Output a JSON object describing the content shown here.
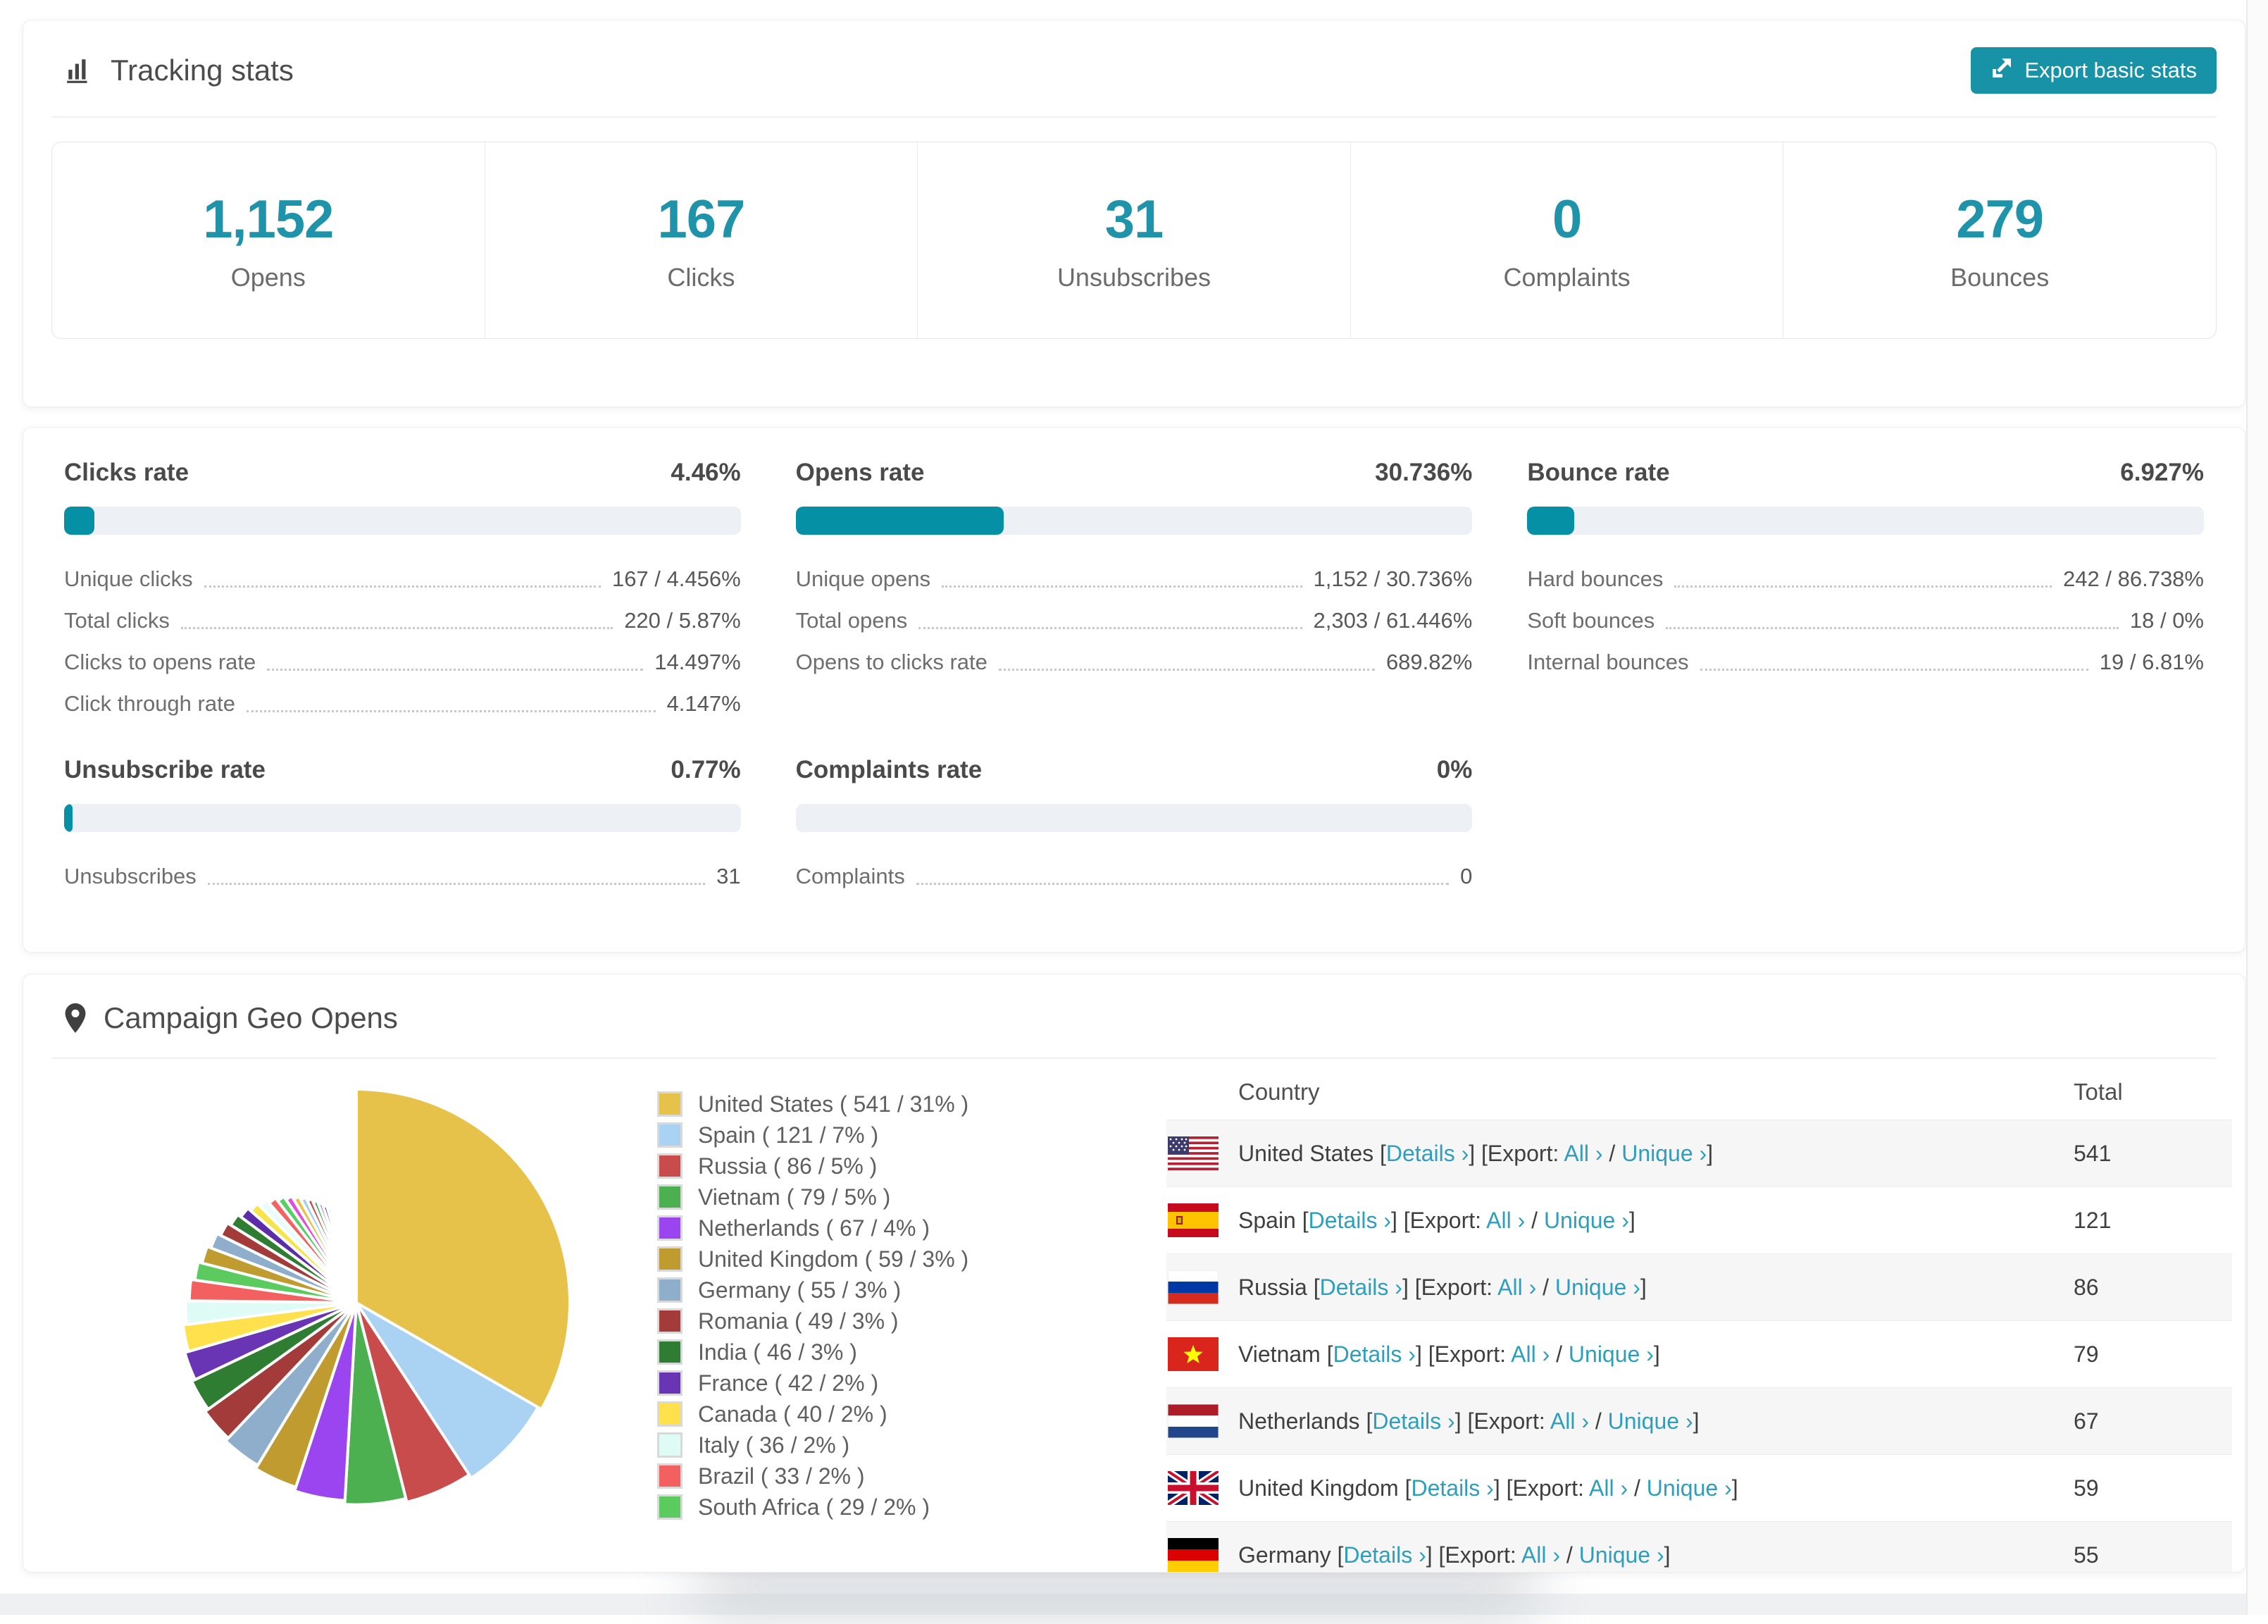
{
  "tracking": {
    "title": "Tracking stats",
    "export_label": "Export basic stats",
    "stats": [
      {
        "value": "1,152",
        "label": "Opens"
      },
      {
        "value": "167",
        "label": "Clicks"
      },
      {
        "value": "31",
        "label": "Unsubscribes"
      },
      {
        "value": "0",
        "label": "Complaints"
      },
      {
        "value": "279",
        "label": "Bounces"
      }
    ]
  },
  "rates": {
    "accent_color": "#0690A5",
    "blocks": [
      {
        "title": "Clicks rate",
        "value": "4.46%",
        "pct": 4.46,
        "rows": [
          [
            "Unique clicks",
            "167 / 4.456%"
          ],
          [
            "Total clicks",
            "220 / 5.87%"
          ],
          [
            "Clicks to opens rate",
            "14.497%"
          ],
          [
            "Click through rate",
            "4.147%"
          ]
        ]
      },
      {
        "title": "Opens rate",
        "value": "30.736%",
        "pct": 30.736,
        "rows": [
          [
            "Unique opens",
            "1,152 / 30.736%"
          ],
          [
            "Total opens",
            "2,303 / 61.446%"
          ],
          [
            "Opens to clicks rate",
            "689.82%"
          ]
        ]
      },
      {
        "title": "Bounce rate",
        "value": "6.927%",
        "pct": 6.927,
        "rows": [
          [
            "Hard bounces",
            "242 / 86.738%"
          ],
          [
            "Soft bounces",
            "18 / 0%"
          ],
          [
            "Internal bounces",
            "19 / 6.81%"
          ]
        ]
      },
      {
        "title": "Unsubscribe rate",
        "value": "0.77%",
        "pct": 0.77,
        "rows": [
          [
            "Unsubscribes",
            "31"
          ]
        ]
      },
      {
        "title": "Complaints rate",
        "value": "0%",
        "pct": 0,
        "rows": [
          [
            "Complaints",
            "0"
          ]
        ]
      }
    ]
  },
  "geo": {
    "title": "Campaign Geo Opens",
    "chart_data": {
      "type": "pie",
      "title": "Campaign Geo Opens",
      "legend_position": "right",
      "start_angle_deg": 0,
      "direction": "clockwise",
      "labels": [
        "United States",
        "Spain",
        "Russia",
        "Vietnam",
        "Netherlands",
        "United Kingdom",
        "Germany",
        "Romania",
        "India",
        "France",
        "Canada",
        "Italy",
        "Brazil",
        "South Africa"
      ],
      "values": [
        541,
        121,
        86,
        79,
        67,
        59,
        55,
        49,
        46,
        42,
        40,
        36,
        33,
        29
      ],
      "percents": [
        31,
        7,
        5,
        5,
        4,
        3,
        3,
        3,
        3,
        2,
        2,
        2,
        2,
        2
      ],
      "colors": [
        "#E6C24B",
        "#AAD2F2",
        "#C94C4C",
        "#4CAF50",
        "#9B45F0",
        "#BF9B30",
        "#8FAECC",
        "#A33B3B",
        "#2E7D32",
        "#6A35B5",
        "#FFE14D",
        "#DFFBF6",
        "#F26060",
        "#5BCB60"
      ],
      "unlabeled_tail_values": [
        28,
        26,
        24,
        22,
        20,
        18,
        17,
        16,
        15,
        14,
        13,
        12,
        11,
        10,
        9,
        9,
        8,
        8,
        7,
        7,
        6,
        6,
        5,
        5,
        4,
        4,
        3,
        3,
        3,
        2,
        2,
        2,
        1,
        1
      ],
      "unlabeled_tail_colors": [
        "#BF9B30",
        "#8FAECC",
        "#A33B3B",
        "#2E7D32",
        "#5B2DA8",
        "#F7E34B",
        "#E8FDFB",
        "#F26363",
        "#57CF63",
        "#DD4FDC",
        "#E6C24B",
        "#9FD0F2",
        "#C94C4C",
        "#3FA84C",
        "#9B45F0",
        "#23236E",
        "#14502B",
        "#6E2420",
        "#5E7C8A",
        "#8A7A20"
      ],
      "legend": [
        {
          "label": "United States ( 541 / 31% )",
          "color": "#E6C24B"
        },
        {
          "label": "Spain ( 121 / 7% )",
          "color": "#AAD2F2"
        },
        {
          "label": "Russia ( 86 / 5% )",
          "color": "#C94C4C"
        },
        {
          "label": "Vietnam ( 79 / 5% )",
          "color": "#4CAF50"
        },
        {
          "label": "Netherlands ( 67 / 4% )",
          "color": "#9B45F0"
        },
        {
          "label": "United Kingdom ( 59 / 3% )",
          "color": "#BF9B30"
        },
        {
          "label": "Germany ( 55 / 3% )",
          "color": "#8FAECC"
        },
        {
          "label": "Romania ( 49 / 3% )",
          "color": "#A33B3B"
        },
        {
          "label": "India ( 46 / 3% )",
          "color": "#2E7D32"
        },
        {
          "label": "France ( 42 / 2% )",
          "color": "#6A35B5"
        },
        {
          "label": "Canada ( 40 / 2% )",
          "color": "#FFE14D"
        },
        {
          "label": "Italy ( 36 / 2% )",
          "color": "#DFFBF6"
        },
        {
          "label": "Brazil ( 33 / 2% )",
          "color": "#F26060"
        },
        {
          "label": "South Africa ( 29 / 2% )",
          "color": "#5BCB60"
        }
      ]
    },
    "table": {
      "headers": [
        "Country",
        "Total"
      ],
      "link_details": "Details ›",
      "link_all": "All ›",
      "link_unique": "Unique ›",
      "glue": {
        "g1": " [",
        "g2": "] [Export: ",
        "g3": " / ",
        "g4": "]"
      },
      "rows": [
        {
          "flag": "us",
          "country": "United States",
          "total": "541"
        },
        {
          "flag": "es",
          "country": "Spain",
          "total": "121"
        },
        {
          "flag": "ru",
          "country": "Russia",
          "total": "86"
        },
        {
          "flag": "vn",
          "country": "Vietnam",
          "total": "79"
        },
        {
          "flag": "nl",
          "country": "Netherlands",
          "total": "67"
        },
        {
          "flag": "gb",
          "country": "United Kingdom",
          "total": "59"
        },
        {
          "flag": "de",
          "country": "Germany",
          "total": "55"
        }
      ]
    }
  }
}
